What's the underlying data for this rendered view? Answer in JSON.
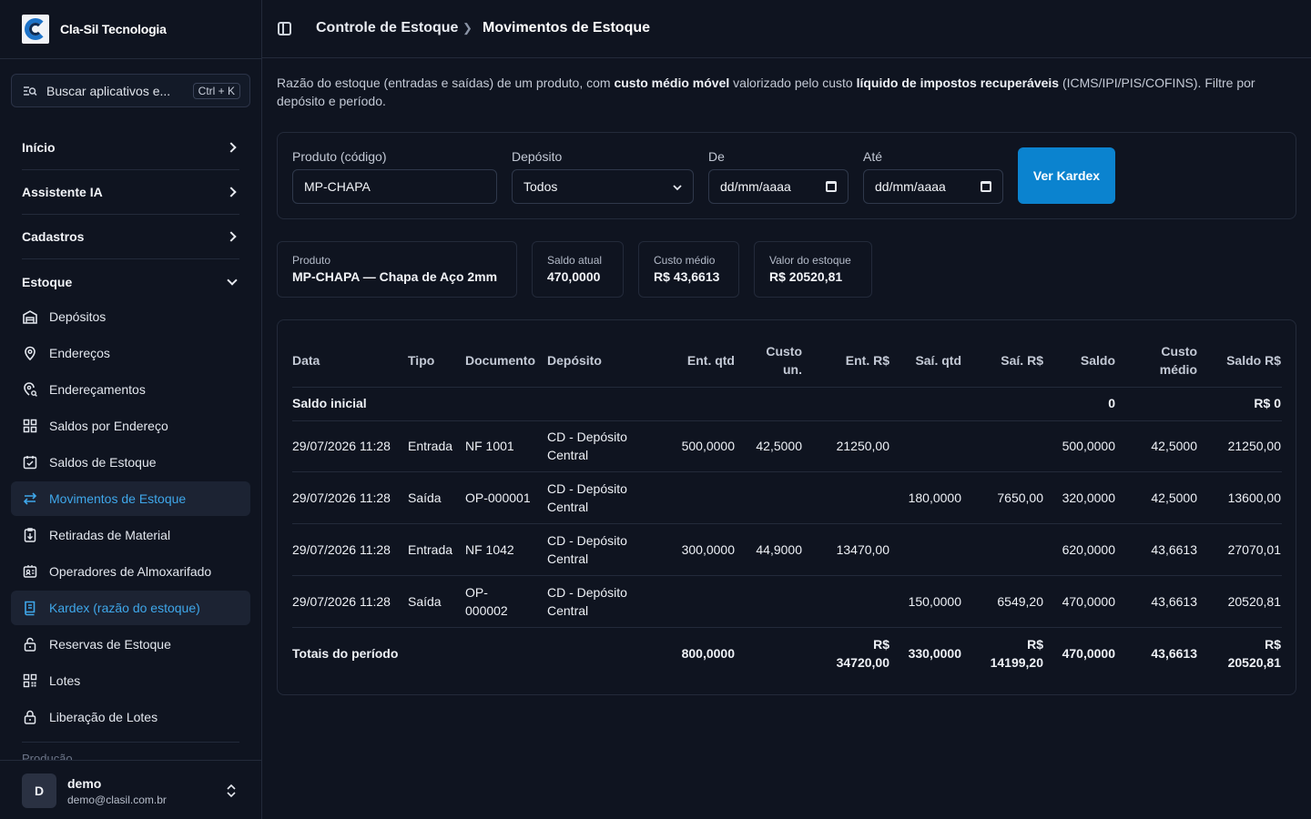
{
  "brand": {
    "name": "Cla-Sil Tecnologia"
  },
  "search": {
    "placeholder": "Buscar aplicativos e...",
    "shortcut": "Ctrl + K"
  },
  "nav": {
    "groups": [
      {
        "label": "Início"
      },
      {
        "label": "Assistente IA"
      },
      {
        "label": "Cadastros"
      },
      {
        "label": "Estoque"
      }
    ],
    "items": [
      {
        "label": "Depósitos",
        "icon": "warehouse-icon"
      },
      {
        "label": "Endereços",
        "icon": "map-pin-icon"
      },
      {
        "label": "Endereçamentos",
        "icon": "map-pin-search-icon"
      },
      {
        "label": "Saldos por Endereço",
        "icon": "grid-icon"
      },
      {
        "label": "Saldos de Estoque",
        "icon": "calendar-check-icon"
      },
      {
        "label": "Movimentos de Estoque",
        "icon": "arrows-left-right-icon"
      },
      {
        "label": "Retiradas de Material",
        "icon": "clipboard-out-icon"
      },
      {
        "label": "Operadores de Almoxarifado",
        "icon": "id-card-icon"
      },
      {
        "label": "Kardex (razão do estoque)",
        "icon": "book-icon"
      },
      {
        "label": "Reservas de Estoque",
        "icon": "lock-open-icon"
      },
      {
        "label": "Lotes",
        "icon": "qr-code-icon"
      },
      {
        "label": "Liberação de Lotes",
        "icon": "lock-icon"
      }
    ],
    "next_group_partial": "Produção"
  },
  "user": {
    "initial": "D",
    "name": "demo",
    "email": "demo@clasil.com.br"
  },
  "header": {
    "crumb1": "Controle de Estoque",
    "crumb2": "Movimentos de Estoque"
  },
  "desc": {
    "p1": "Razão do estoque (entradas e saídas) de um produto, com ",
    "b1": "custo médio móvel",
    "p2": " valorizado pelo custo ",
    "b2": "líquido de impostos recuperáveis",
    "p3": " (ICMS/IPI/PIS/COFINS). Filtre por depósito e período."
  },
  "filters": {
    "produto_label": "Produto (código)",
    "produto_value": "MP-CHAPA",
    "deposito_label": "Depósito",
    "deposito_value": "Todos",
    "de_label": "De",
    "de_placeholder": "dd/mm/aaaa",
    "ate_label": "Até",
    "ate_placeholder": "dd/mm/aaaa",
    "button": "Ver Kardex"
  },
  "summary": [
    {
      "label": "Produto",
      "value": "MP-CHAPA — Chapa de Aço 2mm"
    },
    {
      "label": "Saldo atual",
      "value": "470,0000"
    },
    {
      "label": "Custo médio",
      "value": "R$ 43,6613"
    },
    {
      "label": "Valor do estoque",
      "value": "R$ 20520,81"
    }
  ],
  "table": {
    "headers": {
      "data": "Data",
      "tipo": "Tipo",
      "documento": "Documento",
      "deposito": "Depósito",
      "ent_qtd": "Ent. qtd",
      "custo_un_1": "Custo",
      "custo_un_2": "un.",
      "ent_rs": "Ent. R$",
      "sai_qtd": "Saí. qtd",
      "sai_rs": "Saí. R$",
      "saldo": "Saldo",
      "custo_medio_1": "Custo",
      "custo_medio_2": "médio",
      "saldo_rs": "Saldo R$"
    },
    "initial": {
      "label": "Saldo inicial",
      "saldo": "0",
      "saldo_rs": "R$ 0"
    },
    "rows": [
      {
        "data": "29/07/2026 11:28",
        "tipo": "Entrada",
        "documento": "NF 1001",
        "dep1": "CD - Depósito",
        "dep2": "Central",
        "ent_qtd": "500,0000",
        "custo_un": "42,5000",
        "ent_rs": "21250,00",
        "sai_qtd": "",
        "sai_rs": "",
        "saldo": "500,0000",
        "custo_medio": "42,5000",
        "saldo_rs": "21250,00"
      },
      {
        "data": "29/07/2026 11:28",
        "tipo": "Saída",
        "documento": "OP-000001",
        "dep1": "CD - Depósito",
        "dep2": "Central",
        "ent_qtd": "",
        "custo_un": "",
        "ent_rs": "",
        "sai_qtd": "180,0000",
        "sai_rs": "7650,00",
        "saldo": "320,0000",
        "custo_medio": "42,5000",
        "saldo_rs": "13600,00"
      },
      {
        "data": "29/07/2026 11:28",
        "tipo": "Entrada",
        "documento": "NF 1042",
        "dep1": "CD - Depósito",
        "dep2": "Central",
        "ent_qtd": "300,0000",
        "custo_un": "44,9000",
        "ent_rs": "13470,00",
        "sai_qtd": "",
        "sai_rs": "",
        "saldo": "620,0000",
        "custo_medio": "43,6613",
        "saldo_rs": "27070,01"
      },
      {
        "data": "29/07/2026 11:28",
        "tipo": "Saída",
        "documento": "OP-",
        "documento2": "000002",
        "dep1": "CD - Depósito",
        "dep2": "Central",
        "ent_qtd": "",
        "custo_un": "",
        "ent_rs": "",
        "sai_qtd": "150,0000",
        "sai_rs": "6549,20",
        "saldo": "470,0000",
        "custo_medio": "43,6613",
        "saldo_rs": "20520,81"
      }
    ],
    "totals": {
      "label": "Totais do período",
      "ent_qtd": "800,0000",
      "ent_rs_1": "R$",
      "ent_rs_2": "34720,00",
      "sai_qtd": "330,0000",
      "sai_rs_1": "R$",
      "sai_rs_2": "14199,20",
      "saldo": "470,0000",
      "custo_medio": "43,6613",
      "saldo_rs_1": "R$",
      "saldo_rs_2": "20520,81"
    }
  },
  "colors": {
    "accent": "#0b83cf",
    "active_text": "#3fa7ea",
    "bg": "#0f1420",
    "border": "#232a3a"
  }
}
